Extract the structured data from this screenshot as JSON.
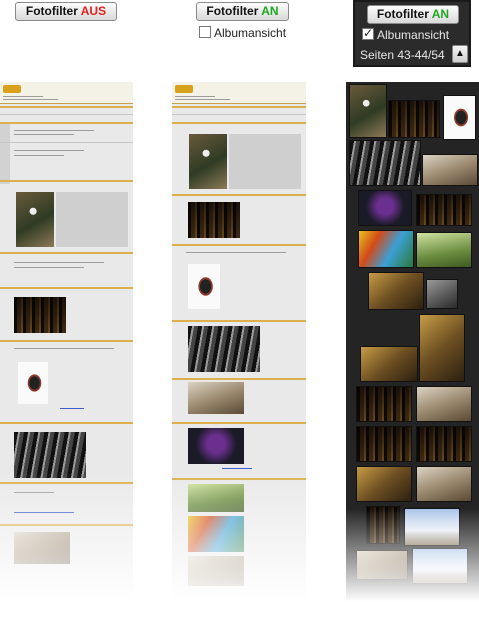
{
  "panels": [
    {
      "button": {
        "label": "Fotofilter",
        "state": "AUS",
        "state_color": "#e0211d"
      }
    },
    {
      "button": {
        "label": "Fotofilter",
        "state": "AN",
        "state_color": "#1fa81f"
      },
      "checkbox": {
        "label": "Albumansicht",
        "checked": false
      }
    },
    {
      "button": {
        "label": "Fotofilter",
        "state": "AN",
        "state_color": "#1fa81f"
      },
      "checkbox": {
        "label": "Albumansicht",
        "checked": true
      },
      "pages": "Seiten 43-44/54",
      "up_icon": "arrow-up-icon"
    }
  ],
  "colors": {
    "forum_accent": "#dcb04f",
    "album_background": "#242424",
    "panel_background": "#2b2b2b"
  }
}
